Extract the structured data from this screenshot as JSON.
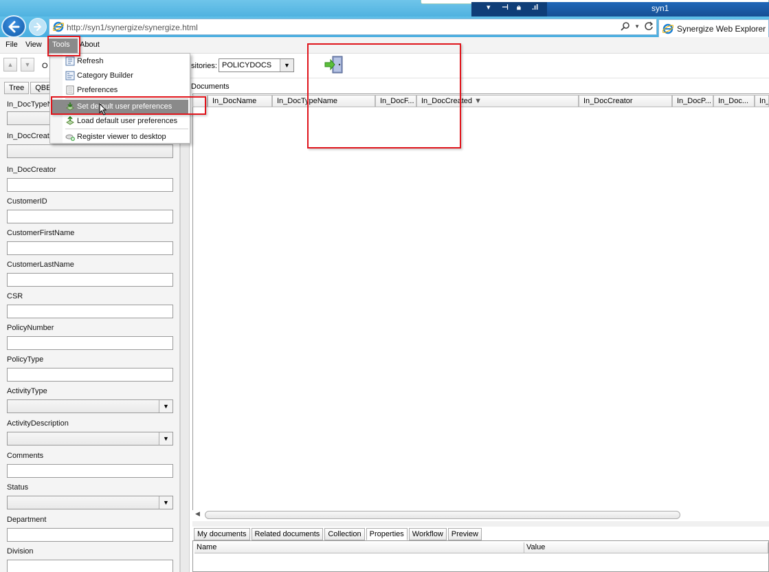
{
  "browser": {
    "taskbar_host": "syn1",
    "url": "http://syn1/synergize/synergize.html",
    "tab_title": "Synergize Web Explorer"
  },
  "menubar": {
    "file": "File",
    "view": "View",
    "tools": "Tools",
    "about": "About"
  },
  "tools_menu": {
    "items": [
      {
        "label": "Refresh",
        "icon": "refresh-icon"
      },
      {
        "label": "Category Builder",
        "icon": "category-builder-icon"
      },
      {
        "label": "Preferences",
        "icon": "preferences-icon"
      },
      {
        "label": "Set default user preferences",
        "icon": "set-default-icon",
        "highlighted": true
      },
      {
        "label": "Load default user preferences",
        "icon": "load-default-icon"
      },
      {
        "label": "Register viewer to desktop",
        "icon": "register-viewer-icon"
      }
    ]
  },
  "toolbar": {
    "partial_label": "O",
    "repositories_label": "sitories:",
    "repository_value": "POLICYDOCS"
  },
  "left_panel": {
    "tabs": [
      "Tree",
      "QBE"
    ],
    "fields": [
      {
        "label": "In_DocTypeN",
        "type": "select"
      },
      {
        "label": "In_DocCreat",
        "type": "select"
      },
      {
        "label": "In_DocCreator",
        "type": "text"
      },
      {
        "label": "CustomerID",
        "type": "text"
      },
      {
        "label": "CustomerFirstName",
        "type": "text"
      },
      {
        "label": "CustomerLastName",
        "type": "text"
      },
      {
        "label": "CSR",
        "type": "text"
      },
      {
        "label": "PolicyNumber",
        "type": "text"
      },
      {
        "label": "PolicyType",
        "type": "text"
      },
      {
        "label": "ActivityType",
        "type": "select"
      },
      {
        "label": "ActivityDescription",
        "type": "select"
      },
      {
        "label": "Comments",
        "type": "text"
      },
      {
        "label": "Status",
        "type": "select"
      },
      {
        "label": "Department",
        "type": "text"
      },
      {
        "label": "Division",
        "type": "text"
      }
    ]
  },
  "documents": {
    "title": "Documents",
    "columns": [
      "In_DocName",
      "In_DocTypeName",
      "In_DocF...",
      "In_DocCreated",
      "In_DocCreator",
      "In_DocP...",
      "In_Doc...",
      "In_"
    ],
    "sort_indicator": "▼"
  },
  "bottom_tabs": [
    "My documents",
    "Related documents",
    "Collection",
    "Properties",
    "Workflow",
    "Preview"
  ],
  "active_bottom_tab": "Properties",
  "properties": {
    "name_header": "Name",
    "value_header": "Value"
  },
  "colors": {
    "chrome_blue": "#4fb2e0",
    "menu_highlight": "#8a8a8a",
    "annotation_red": "#e0141b"
  }
}
